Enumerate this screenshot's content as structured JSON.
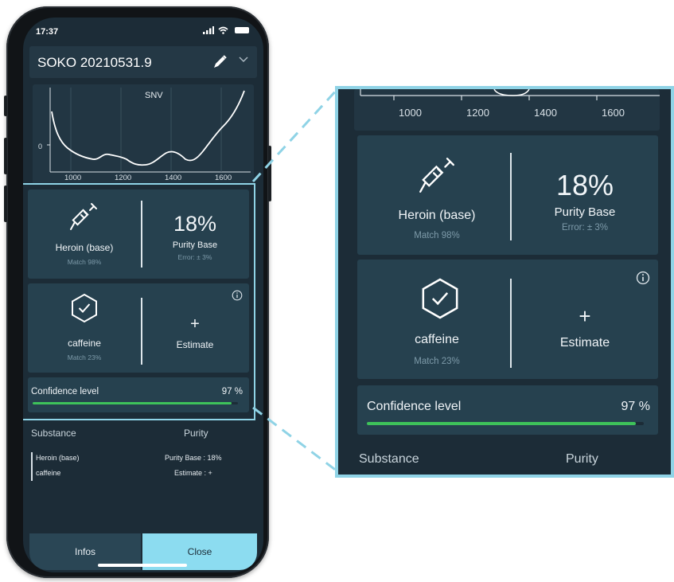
{
  "status": {
    "time": "17:37",
    "signal": "..ıl",
    "wifi": "wifi"
  },
  "header": {
    "title": "SOKO 20210531.9",
    "edit_icon": "pencil-icon",
    "expand_icon": "chevron-down-icon"
  },
  "spectrum": {
    "label": "SNV",
    "y_tick": "0",
    "x_ticks": [
      "1000",
      "1200",
      "1400",
      "1600"
    ]
  },
  "results": {
    "primary": {
      "icon": "syringe-icon",
      "substance": "Heroin (base)",
      "match": "Match 98%",
      "purity_value": "18%",
      "purity_label": "Purity Base",
      "purity_error": "Error: ± 3%"
    },
    "secondary": {
      "icon": "hexagon-check-icon",
      "substance": "caffeine",
      "match": "Match 23%",
      "action_symbol": "+",
      "action_label": "Estimate",
      "info_icon": "info-icon"
    },
    "confidence": {
      "label": "Confidence level",
      "value": "97 %",
      "level": 0.97
    }
  },
  "table": {
    "headers": {
      "substance": "Substance",
      "purity": "Purity"
    },
    "rows": [
      {
        "substance": "Heroin (base)",
        "purity": "Purity Base : 18%"
      },
      {
        "substance": "caffeine",
        "purity": "Estimate : +"
      }
    ]
  },
  "footer": {
    "infos_label": "Infos",
    "close_label": "Close"
  },
  "colors": {
    "accent": "#8cdcf0",
    "confidence": "#3ec25a",
    "background": "#1c2c37",
    "card": "#26414f"
  }
}
